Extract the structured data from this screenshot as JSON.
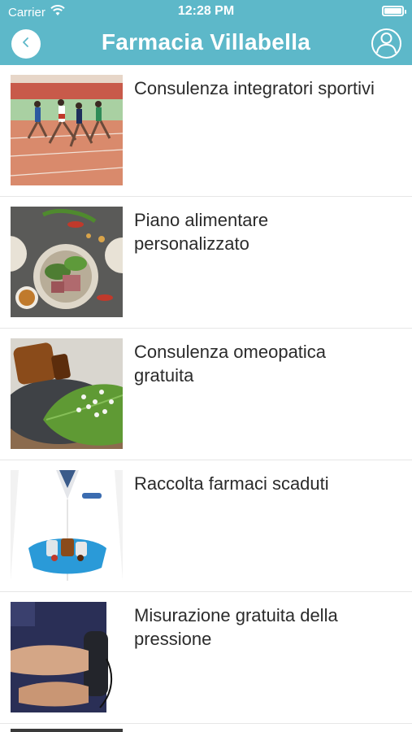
{
  "status_bar": {
    "carrier": "Carrier",
    "time": "12:28 PM"
  },
  "header": {
    "title": "Farmacia Villabella"
  },
  "services": [
    {
      "label": "Consulenza integratori sportivi",
      "image": "runners-on-track"
    },
    {
      "label": "Piano alimentare personalizzato",
      "image": "meal-bowl-greens"
    },
    {
      "label": "Consulenza omeopatica gratuita",
      "image": "homeopathy-bottle-pills"
    },
    {
      "label": "Raccolta farmaci scaduti",
      "image": "pharmacist-gloves-medicines"
    },
    {
      "label": "Misurazione gratuita della pressione",
      "image": "blood-pressure-cuff"
    }
  ],
  "colors": {
    "header_bg": "#5db8c9",
    "text": "#2b2b2b",
    "divider": "#e6e6e6"
  }
}
